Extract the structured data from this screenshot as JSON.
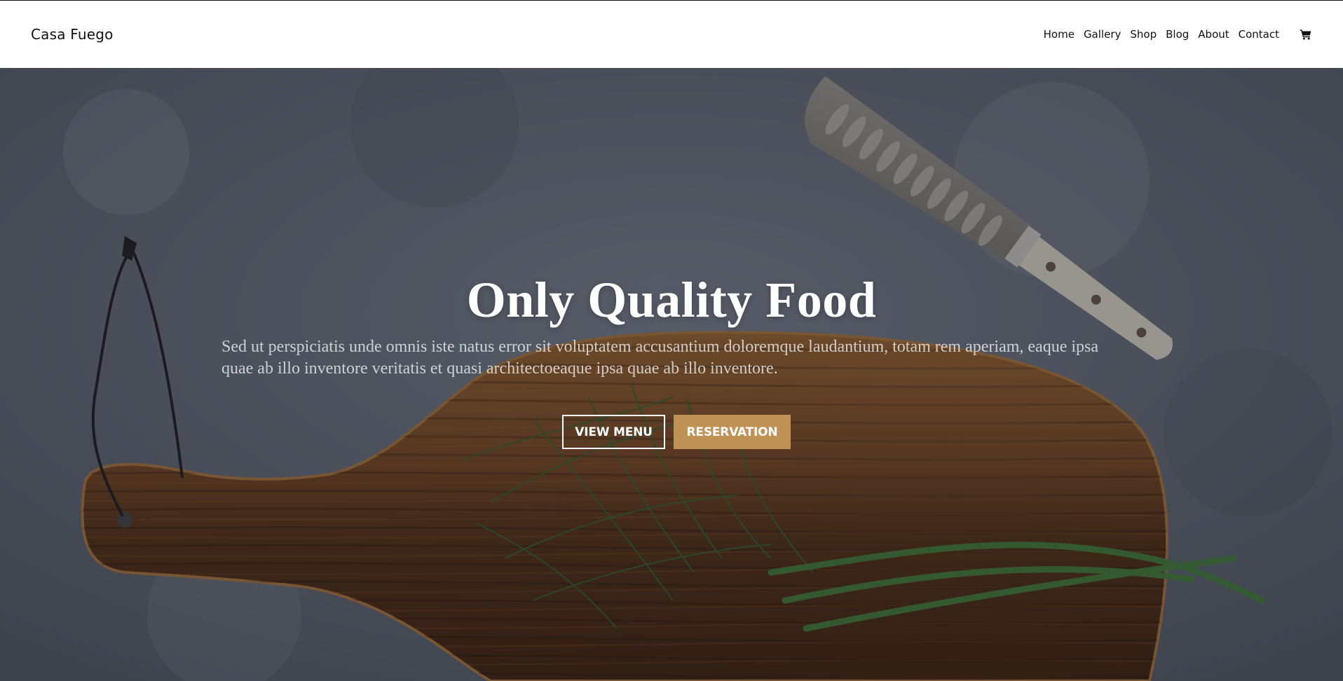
{
  "header": {
    "brand": "Casa Fuego",
    "nav": [
      {
        "label": "Home"
      },
      {
        "label": "Gallery"
      },
      {
        "label": "Shop"
      },
      {
        "label": "Blog"
      },
      {
        "label": "About"
      },
      {
        "label": "Contact"
      }
    ],
    "cart_icon": "shopping-cart-icon"
  },
  "hero": {
    "title": "Only Quality Food",
    "text": "Sed ut perspiciatis unde omnis iste natus error sit voluptatem accusantium doloremque laudantium, totam rem aperiam, eaque ipsa quae ab illo inventore veritatis et quasi architectoeaque ipsa quae ab illo inventore.",
    "buttons": {
      "view_menu": "VIEW MENU",
      "reservation": "RESERVATION"
    },
    "background": "cutting-board-with-dill-and-knife-photo"
  },
  "colors": {
    "accent": "#c19255",
    "nav_bg": "#ffffff",
    "text_dark": "#111111"
  }
}
